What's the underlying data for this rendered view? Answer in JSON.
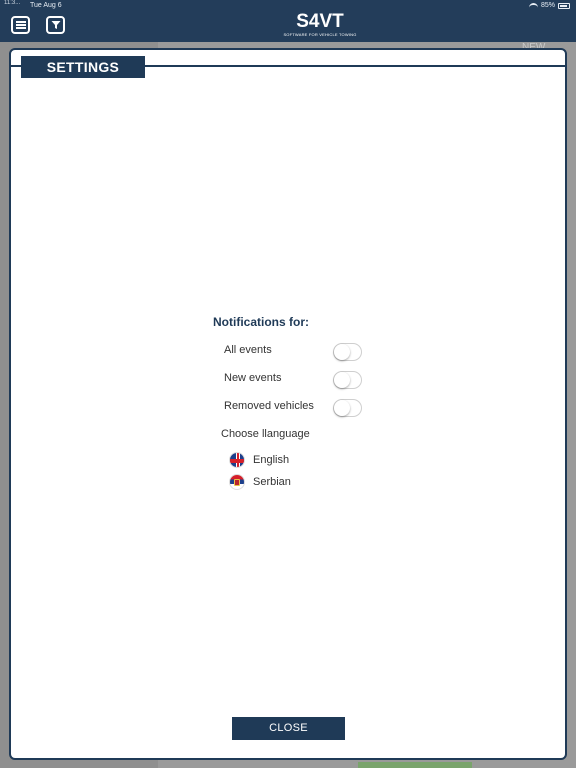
{
  "status_bar": {
    "time": "11:3...",
    "date": "Tue Aug 6",
    "battery": "85%"
  },
  "header": {
    "logo": "S4VT",
    "tagline": "SOFTWARE FOR VEHICLE TOWING"
  },
  "background": {
    "new_label": "NEW"
  },
  "modal": {
    "title": "SETTINGS",
    "notifications_title": "Notifications for:",
    "notifications": [
      {
        "label": "All events",
        "enabled": false
      },
      {
        "label": "New events",
        "enabled": false
      },
      {
        "label": "Removed vehicles",
        "enabled": false
      }
    ],
    "language_title": "Choose llanguage",
    "languages": [
      {
        "label": "English",
        "flag": "uk-flag-icon"
      },
      {
        "label": "Serbian",
        "flag": "serbia-flag-icon"
      }
    ],
    "close_label": "CLOSE"
  },
  "colors": {
    "primary": "#1f3a57",
    "header": "#233d5a"
  }
}
